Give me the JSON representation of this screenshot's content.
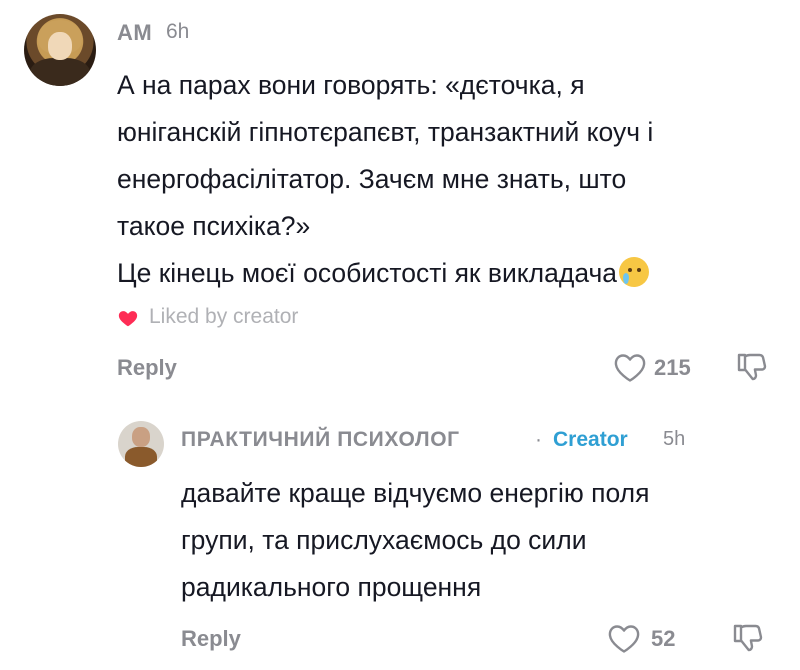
{
  "comment": {
    "username": "AM",
    "time": "6h",
    "text_lines": [
      "А на парах вони говорять: «дєточка, я",
      "юніганскій гіпнотєрапєвт, транзактний коуч і",
      "енергофасілітатор. Зачєм мне знать, што",
      "такое психіка?»",
      "Це кінець моєї особистості як викладача"
    ],
    "emoji": "crying-face",
    "liked_by": "Liked by creator",
    "reply_label": "Reply",
    "like_count": "215",
    "icons": {
      "like": "heart-outline-icon",
      "dislike": "thumbs-down-icon",
      "liked": "heart-filled-icon"
    }
  },
  "reply": {
    "author": "ПРАКТИЧНИЙ ПСИХОЛОГ",
    "separator": "·",
    "badge": "Creator",
    "time": "5h",
    "text_lines": [
      "давайте краще відчуємо енергію поля",
      "групи, та прислухаємось до сили",
      "радикального прощення"
    ],
    "reply_label": "Reply",
    "like_count": "52"
  },
  "colors": {
    "text": "#161823",
    "muted": "#8a8b91",
    "creator_badge": "#2f9fd3",
    "liked_heart": "#fe2c55"
  }
}
